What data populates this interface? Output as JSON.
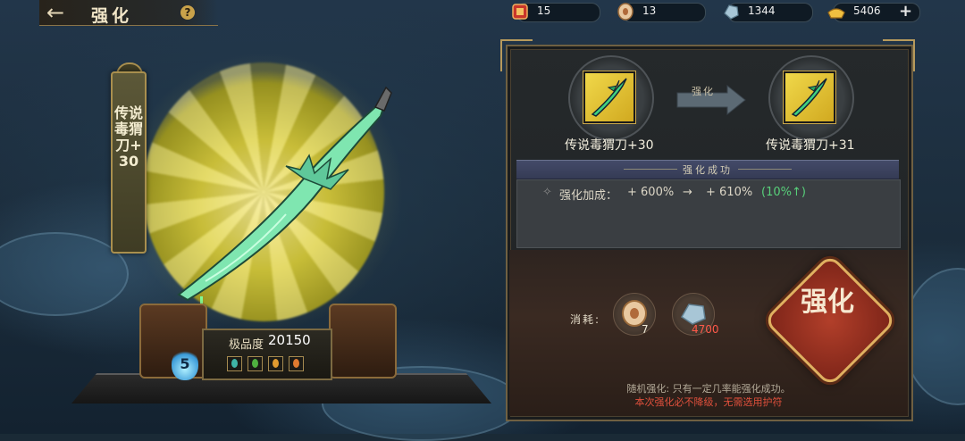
{
  "header": {
    "title": "强化",
    "back_icon": "arrow-left-icon",
    "help_label": "?"
  },
  "resources": [
    {
      "icon": "red-token-icon",
      "value": "15"
    },
    {
      "icon": "coin-icon",
      "value": "13"
    },
    {
      "icon": "ore-icon",
      "value": "1344"
    },
    {
      "icon": "gold-ingot-icon",
      "value": "5406"
    }
  ],
  "resources_add_label": "+",
  "weapon": {
    "banner_name": "传说毒猬刀+30",
    "grade_label": "极品度",
    "grade_value": "20150",
    "level": "5",
    "gems": [
      "#3fb4a8",
      "#4fb040",
      "#e09a30",
      "#e07a30"
    ]
  },
  "upgrade": {
    "arrow_label": "强化",
    "from_name": "传说毒猬刀+30",
    "to_name": "传说毒猬刀+31",
    "result_title": "强化成功",
    "stat_label": "强化加成：",
    "stat_from": "+ 600%",
    "stat_arrow": "→",
    "stat_to": "+ 610%",
    "stat_delta": "(10%↑)"
  },
  "cost": {
    "label": "消耗:",
    "items": [
      {
        "icon": "coin-icon",
        "value": "7",
        "color": "#f0ead8"
      },
      {
        "icon": "ore-icon",
        "value": "4700",
        "color": "#ff5a4a"
      }
    ]
  },
  "action": {
    "button_label": "强化"
  },
  "notes": {
    "line1": "随机强化: 只有一定几率能强化成功。",
    "line2": "本次强化必不降级，无需选用护符"
  },
  "colors": {
    "accent_gold": "#b79a5c",
    "success_green": "#58d07a",
    "warning_red": "#e0503c"
  }
}
